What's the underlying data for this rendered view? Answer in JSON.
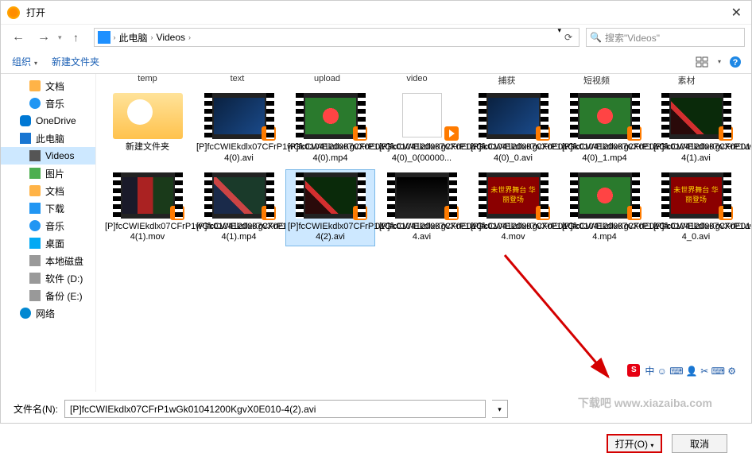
{
  "window": {
    "title": "打开"
  },
  "nav": {
    "back": "←",
    "fwd": "→",
    "up": "↑",
    "refresh": "⟳"
  },
  "breadcrumb": {
    "root": "此电脑",
    "folder": "Videos"
  },
  "search": {
    "placeholder": "搜索\"Videos\""
  },
  "toolbar": {
    "organize": "组织",
    "newfolder": "新建文件夹"
  },
  "sidebar": [
    {
      "label": "文档",
      "cls": "folder",
      "indent": true
    },
    {
      "label": "音乐",
      "cls": "music",
      "indent": true
    },
    {
      "label": "OneDrive",
      "cls": "cloud"
    },
    {
      "label": "此电脑",
      "cls": "pc"
    },
    {
      "label": "Videos",
      "cls": "video",
      "indent": true,
      "selected": true
    },
    {
      "label": "图片",
      "cls": "pic",
      "indent": true
    },
    {
      "label": "文档",
      "cls": "folder",
      "indent": true
    },
    {
      "label": "下载",
      "cls": "down",
      "indent": true
    },
    {
      "label": "音乐",
      "cls": "music",
      "indent": true
    },
    {
      "label": "桌面",
      "cls": "desk",
      "indent": true
    },
    {
      "label": "本地磁盘",
      "cls": "disk",
      "indent": true
    },
    {
      "label": "软件 (D:)",
      "cls": "disk",
      "indent": true
    },
    {
      "label": "备份 (E:)",
      "cls": "disk",
      "indent": true
    },
    {
      "label": "网络",
      "cls": "net"
    }
  ],
  "top_labels": [
    "temp",
    "text",
    "upload",
    "video",
    "捕获",
    "短视频",
    "素材"
  ],
  "files_row1": [
    {
      "name": "新建文件夹",
      "thumb": "folder"
    },
    {
      "name": "[P]fcCWIEkdlx07CFrP1wGk01041200KgvX0E010-4(0).avi",
      "thumb": "g-blue"
    },
    {
      "name": "[P]fcCWIEkdlx07CFrP1wGk01041200KgvX0E010-4(0).mp4",
      "thumb": "g-flower"
    },
    {
      "name": "[P]fcCWIEkdlx07CFrP1wGk01041200KgvX0E010-4(0)_0(00000...",
      "thumb": "g-file"
    },
    {
      "name": "[P]fcCWIEkdlx07CFrP1wGk01041200KgvX0E010-4(0)_0.avi",
      "thumb": "g-blue"
    },
    {
      "name": "[P]fcCWIEkdlx07CFrP1wGk01041200KgvX0E010-4(0)_1.mp4",
      "thumb": "g-flower"
    },
    {
      "name": "[P]fcCWIEkdlx07CFrP1wGk01041200KgvX0E010-4(1).avi",
      "thumb": "g-red"
    }
  ],
  "files_row2": [
    {
      "name": "[P]fcCWIEkdlx07CFrP1wGk01041200KgvX0E010-4(1).mov",
      "thumb": "g-mix"
    },
    {
      "name": "[P]fcCWIEkdlx07CFrP1wGk01041200KgvX0E010-4(1).mp4",
      "thumb": "g-bluered"
    },
    {
      "name": "[P]fcCWIEkdlx07CFrP1wGk01041200KgvX0E010-4(2).avi",
      "thumb": "g-red",
      "selected": true
    },
    {
      "name": "[P]fcCWIEkdlx07CFrP1wGk01041200KgvX0E010-4.avi",
      "thumb": "g-dark"
    },
    {
      "name": "[P]fcCWIEkdlx07CFrP1wGk01041200KgvX0E010-4.mov",
      "thumb": "g-cn",
      "text": "未世界舞台 华丽登场"
    },
    {
      "name": "[P]fcCWIEkdlx07CFrP1wGk01041200KgvX0E010-4.mp4",
      "thumb": "g-flower"
    },
    {
      "name": "[P]fcCWIEkdlx07CFrP1wGk01041200KgvX0E010-4_0.avi",
      "thumb": "g-cn",
      "text": "未世界舞台 华丽登场"
    }
  ],
  "footer": {
    "filename_label": "文件名(N):",
    "filename_value": "[P]fcCWIEkdlx07CFrP1wGk01041200KgvX0E010-4(2).avi",
    "open": "打开(O)",
    "cancel": "取消"
  },
  "ime": {
    "logo": "S",
    "chars": "中 ☺ ⌨ 👤 ✂ ⌨ ⚙"
  },
  "watermark": "下载吧 www.xiazaiba.com"
}
